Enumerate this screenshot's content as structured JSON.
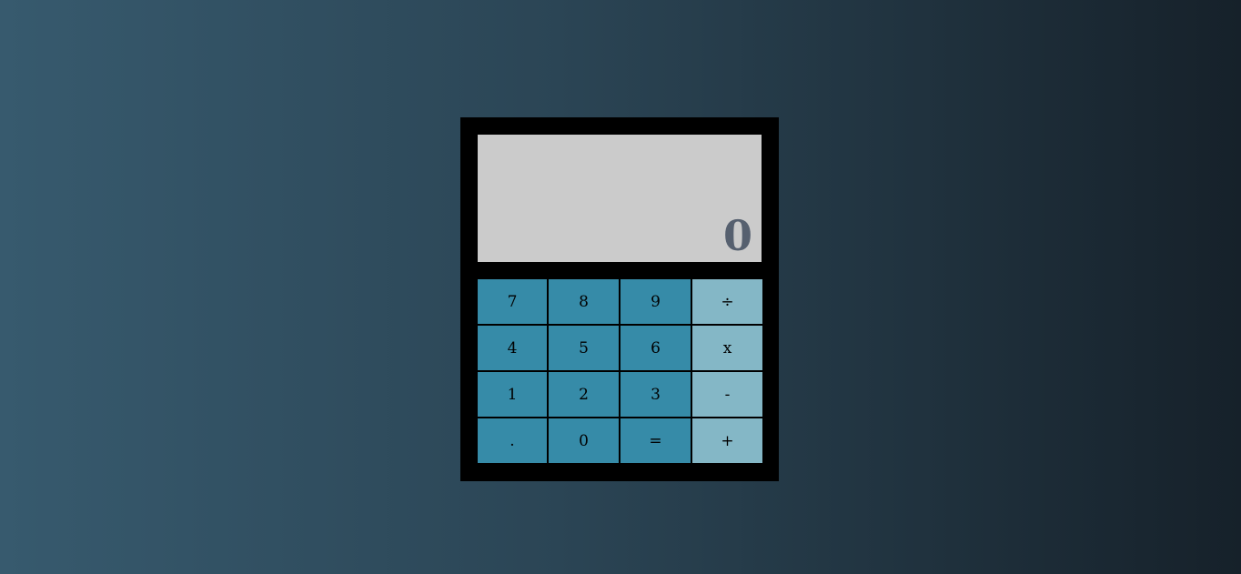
{
  "display": {
    "value": "0"
  },
  "keypad": {
    "rows": [
      [
        {
          "label": "7",
          "type": "digit"
        },
        {
          "label": "8",
          "type": "digit"
        },
        {
          "label": "9",
          "type": "digit"
        },
        {
          "label": "÷",
          "type": "operator"
        }
      ],
      [
        {
          "label": "4",
          "type": "digit"
        },
        {
          "label": "5",
          "type": "digit"
        },
        {
          "label": "6",
          "type": "digit"
        },
        {
          "label": "x",
          "type": "operator"
        }
      ],
      [
        {
          "label": "1",
          "type": "digit"
        },
        {
          "label": "2",
          "type": "digit"
        },
        {
          "label": "3",
          "type": "digit"
        },
        {
          "label": "-",
          "type": "operator"
        }
      ],
      [
        {
          "label": ".",
          "type": "digit"
        },
        {
          "label": "0",
          "type": "digit"
        },
        {
          "label": "=",
          "type": "digit"
        },
        {
          "label": "+",
          "type": "operator"
        }
      ]
    ]
  },
  "colors": {
    "digit_key": "#368ba8",
    "operator_key": "#84b7c6",
    "display_bg": "#cbcbcb",
    "display_text": "#56606f",
    "body": "#000000"
  }
}
